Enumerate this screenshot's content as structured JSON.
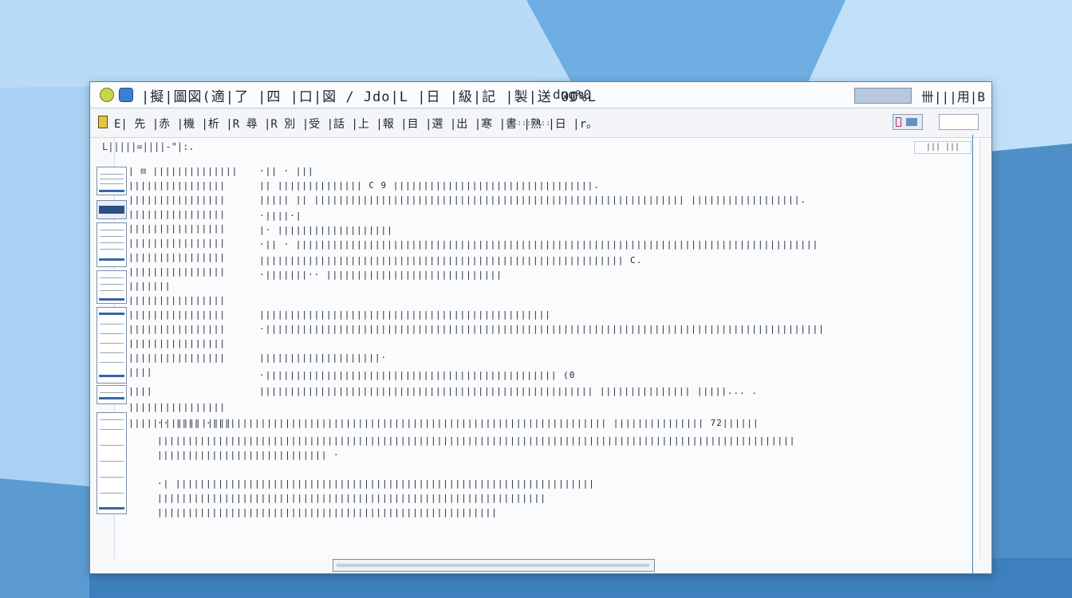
{
  "titlebar": {
    "title": "|擬|圖図(適|了 |四 |口|図 / Jdo|L |日 |級|記 |製|送 00%L",
    "sub": "dug%0",
    "control_button": "",
    "control_text": "卌|||用|B"
  },
  "toolbar": {
    "path": "E| 先 |赤 |機 |析 |R 尋 |R 別 |受 |話 |上 |報 |目 |選 |出 |寒 |書 |熟 |日 |r。",
    "extra": "::: :::"
  },
  "content": {
    "header": "L|||||=||||-\"|:.",
    "tools": "||| |||"
  },
  "doc": {
    "left_lines": [
      "| ⊟ ||||||||||||||",
      "||||||||||||||||",
      "||||||||||||||||",
      "||||||||||||||||",
      "||||||||||||||||",
      "||||||||||||||||",
      "||||||||||||||||",
      "||||||||||||||||",
      "|||||||",
      "||||||||||||||||",
      "||||||||||||||||",
      "||||||||||||||||",
      "||||||||||||||||",
      "||||||||||||||||",
      "||||",
      "||||",
      "||||||||||||||||",
      "|||||||||||||||||"
    ],
    "right_lines": [
      "·|| · |||",
      "|| |||||||||||||| C 9 |||||||||||||||||||||||||||||||||.",
      "||||| || ||||||||||||||||||||||||||||||||||||||||||||||||||||||||||||| ||||||||||||||||||.",
      "·||||·|",
      "|· |||||||||||||||||||",
      "·|| · ||||||||||||||||||||||||||||||||||||||||||||||||||||||||||||||||||||||||||||||||||||||",
      "|||||||||||||||||||||||||||||||||||||||||||||||||||||||||||| C.",
      "·|||||||·· |||||||||||||||||||||||||||||",
      "||||||||||||||||||||||||||||||||||||||||||||||||",
      "·||||||||||||||||||||||||||||||||||||||||||||||||||||||||||||||||||||||||||||||||||||||||||||",
      "||||||||||||||||||||·",
      "·|||||||||||||||||||||||||||||||||||||||||||||||| (0",
      "||||||||||||||||||||||||||||||||||||||||||||||||||||||| ||||||||||||||| |||||... ."
    ],
    "wide_lines": [
      "·· |||| ·||||||||||||||||||||||||||||||||||||||||||||||||||||||||||||||||| ||||||||||||||| 72||||||",
      "|||||||||||||||||||||||||||||||||||||||||||||||||||||||||||||||||||||||||||||||||||||||||||||||||||||||||",
      "|||||||||||||||||||||||||||| ·",
      "·| |||||||||||||||||||||||||||||||||||||||||||||||||||||||||||||||||||||",
      "||||||||||||||||||||||||||||||||||||||||||||||||||||||||||||||||",
      "||||||||||||||||||||||||||||||||||||||||||||||||||||||||"
    ]
  },
  "colors": {
    "window_bg": "#f7f8fa",
    "accent": "#3b7fd1",
    "desktop": "#8fc2ea"
  }
}
